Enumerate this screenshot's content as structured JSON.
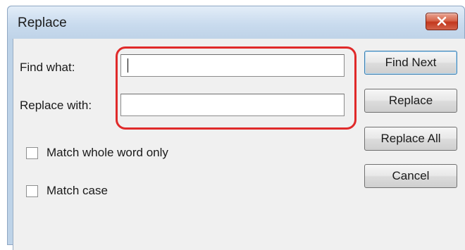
{
  "dialog": {
    "title": "Replace",
    "close_icon": "close-icon"
  },
  "fields": {
    "find_label": "Find what:",
    "find_value": "",
    "replace_label": "Replace with:",
    "replace_value": ""
  },
  "options": {
    "whole_word_label": "Match whole word only",
    "whole_word_checked": false,
    "match_case_label": "Match case",
    "match_case_checked": false
  },
  "buttons": {
    "find_next": "Find Next",
    "replace": "Replace",
    "replace_all": "Replace All",
    "cancel": "Cancel"
  },
  "colors": {
    "highlight": "#e02a2a",
    "close_button": "#c3381e"
  }
}
